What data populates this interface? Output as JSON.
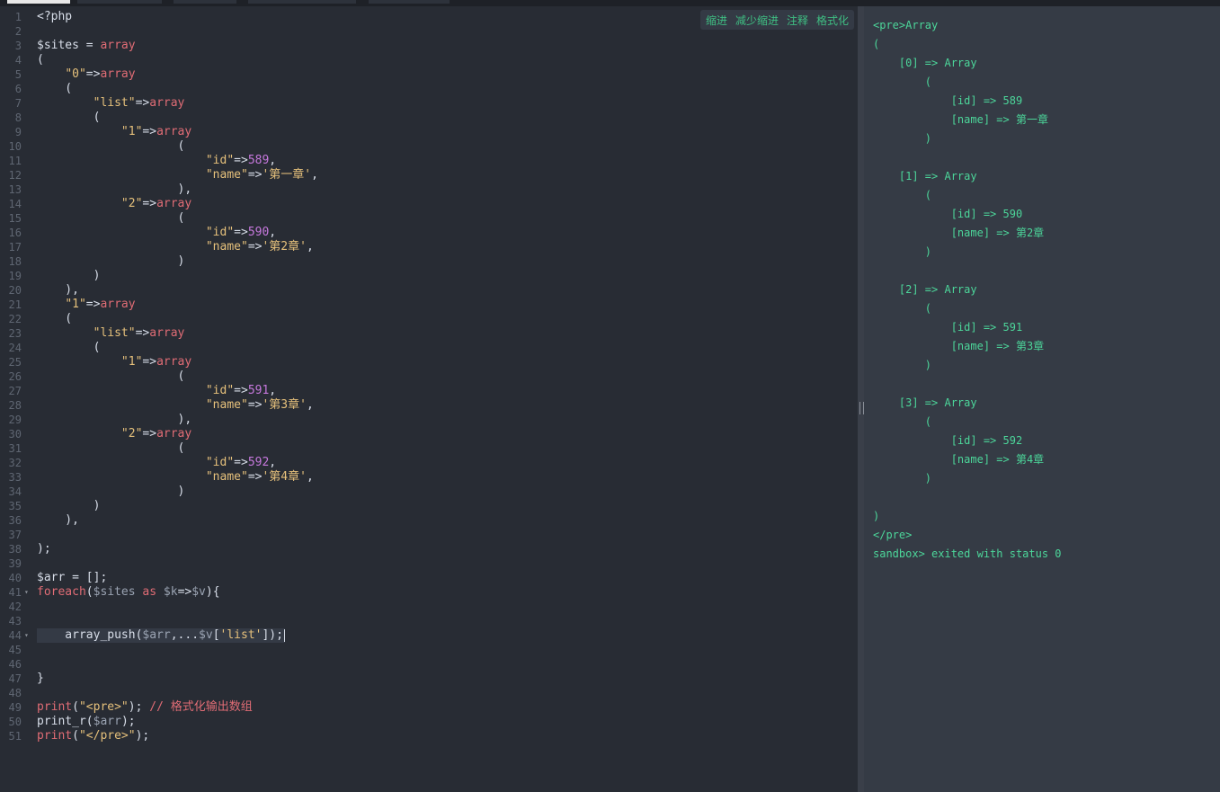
{
  "toolbar": {
    "indent": "缩进",
    "outdent": "减少缩进",
    "comment": "注释",
    "format": "格式化"
  },
  "editor": {
    "line_numbers": [
      "1",
      "2",
      "3",
      "4",
      "5",
      "6",
      "7",
      "8",
      "9",
      "10",
      "11",
      "12",
      "13",
      "14",
      "15",
      "16",
      "17",
      "18",
      "19",
      "20",
      "21",
      "22",
      "23",
      "24",
      "25",
      "26",
      "27",
      "28",
      "29",
      "30",
      "31",
      "32",
      "33",
      "34",
      "35",
      "36",
      "37",
      "38",
      "39",
      "40",
      "41",
      "42",
      "43",
      "44",
      "45",
      "46",
      "47",
      "48",
      "49",
      "50",
      "51"
    ],
    "lines": [
      [
        [
          "pl",
          "<?php"
        ]
      ],
      [],
      [
        [
          "var",
          "$sites"
        ],
        [
          "pl",
          " = "
        ],
        [
          "kw",
          "array"
        ]
      ],
      [
        [
          "pl",
          "("
        ]
      ],
      [
        [
          "pl",
          "    "
        ],
        [
          "str",
          "\"0\""
        ],
        [
          "pl",
          "=>"
        ],
        [
          "kw",
          "array"
        ]
      ],
      [
        [
          "pl",
          "    ("
        ]
      ],
      [
        [
          "pl",
          "        "
        ],
        [
          "str",
          "\"list\""
        ],
        [
          "pl",
          "=>"
        ],
        [
          "kw",
          "array"
        ]
      ],
      [
        [
          "pl",
          "        ("
        ]
      ],
      [
        [
          "pl",
          "            "
        ],
        [
          "str",
          "\"1\""
        ],
        [
          "pl",
          "=>"
        ],
        [
          "kw",
          "array"
        ]
      ],
      [
        [
          "pl",
          "                    ("
        ]
      ],
      [
        [
          "pl",
          "                        "
        ],
        [
          "str",
          "\"id\""
        ],
        [
          "pl",
          "=>"
        ],
        [
          "num",
          "589"
        ],
        [
          "pl",
          ","
        ]
      ],
      [
        [
          "pl",
          "                        "
        ],
        [
          "str",
          "\"name\""
        ],
        [
          "pl",
          "=>"
        ],
        [
          "str",
          "'第一章'"
        ],
        [
          "pl",
          ","
        ]
      ],
      [
        [
          "pl",
          "                    ),"
        ]
      ],
      [
        [
          "pl",
          "            "
        ],
        [
          "str",
          "\"2\""
        ],
        [
          "pl",
          "=>"
        ],
        [
          "kw",
          "array"
        ]
      ],
      [
        [
          "pl",
          "                    ("
        ]
      ],
      [
        [
          "pl",
          "                        "
        ],
        [
          "str",
          "\"id\""
        ],
        [
          "pl",
          "=>"
        ],
        [
          "num",
          "590"
        ],
        [
          "pl",
          ","
        ]
      ],
      [
        [
          "pl",
          "                        "
        ],
        [
          "str",
          "\"name\""
        ],
        [
          "pl",
          "=>"
        ],
        [
          "str",
          "'第2章'"
        ],
        [
          "pl",
          ","
        ]
      ],
      [
        [
          "pl",
          "                    )"
        ]
      ],
      [
        [
          "pl",
          "        )"
        ]
      ],
      [
        [
          "pl",
          "    ),"
        ]
      ],
      [
        [
          "pl",
          "    "
        ],
        [
          "str",
          "\"1\""
        ],
        [
          "pl",
          "=>"
        ],
        [
          "kw",
          "array"
        ]
      ],
      [
        [
          "pl",
          "    ("
        ]
      ],
      [
        [
          "pl",
          "        "
        ],
        [
          "str",
          "\"list\""
        ],
        [
          "pl",
          "=>"
        ],
        [
          "kw",
          "array"
        ]
      ],
      [
        [
          "pl",
          "        ("
        ]
      ],
      [
        [
          "pl",
          "            "
        ],
        [
          "str",
          "\"1\""
        ],
        [
          "pl",
          "=>"
        ],
        [
          "kw",
          "array"
        ]
      ],
      [
        [
          "pl",
          "                    ("
        ]
      ],
      [
        [
          "pl",
          "                        "
        ],
        [
          "str",
          "\"id\""
        ],
        [
          "pl",
          "=>"
        ],
        [
          "num",
          "591"
        ],
        [
          "pl",
          ","
        ]
      ],
      [
        [
          "pl",
          "                        "
        ],
        [
          "str",
          "\"name\""
        ],
        [
          "pl",
          "=>"
        ],
        [
          "str",
          "'第3章'"
        ],
        [
          "pl",
          ","
        ]
      ],
      [
        [
          "pl",
          "                    ),"
        ]
      ],
      [
        [
          "pl",
          "            "
        ],
        [
          "str",
          "\"2\""
        ],
        [
          "pl",
          "=>"
        ],
        [
          "kw",
          "array"
        ]
      ],
      [
        [
          "pl",
          "                    ("
        ]
      ],
      [
        [
          "pl",
          "                        "
        ],
        [
          "str",
          "\"id\""
        ],
        [
          "pl",
          "=>"
        ],
        [
          "num",
          "592"
        ],
        [
          "pl",
          ","
        ]
      ],
      [
        [
          "pl",
          "                        "
        ],
        [
          "str",
          "\"name\""
        ],
        [
          "pl",
          "=>"
        ],
        [
          "str",
          "'第4章'"
        ],
        [
          "pl",
          ","
        ]
      ],
      [
        [
          "pl",
          "                    )"
        ]
      ],
      [
        [
          "pl",
          "        )"
        ]
      ],
      [
        [
          "pl",
          "    ),"
        ]
      ],
      [],
      [
        [
          "pl",
          ");"
        ]
      ],
      [],
      [
        [
          "var",
          "$arr"
        ],
        [
          "pl",
          " = [];"
        ]
      ],
      [
        [
          "kw",
          "foreach"
        ],
        [
          "pl",
          "("
        ],
        [
          "var2",
          "$sites"
        ],
        [
          "pl",
          " "
        ],
        [
          "kw",
          "as"
        ],
        [
          "pl",
          " "
        ],
        [
          "var2",
          "$k"
        ],
        [
          "pl",
          "=>"
        ],
        [
          "var2",
          "$v"
        ],
        [
          "pl",
          "){"
        ]
      ],
      [],
      [],
      [
        [
          "pl",
          "    array_push("
        ],
        [
          "var2",
          "$arr"
        ],
        [
          "pl",
          ",..."
        ],
        [
          "var2",
          "$v"
        ],
        [
          "pl",
          "["
        ],
        [
          "str",
          "'list'"
        ],
        [
          "pl",
          "]);"
        ]
      ],
      [],
      [],
      [
        [
          "pl",
          "}"
        ]
      ],
      [],
      [
        [
          "kw",
          "print"
        ],
        [
          "pl",
          "("
        ],
        [
          "str",
          "\"<pre>\""
        ],
        [
          "pl",
          "); "
        ],
        [
          "cm",
          "// 格式化输出数组"
        ]
      ],
      [
        [
          "pl",
          "print_r("
        ],
        [
          "var2",
          "$arr"
        ],
        [
          "pl",
          ");"
        ]
      ],
      [
        [
          "kw",
          "print"
        ],
        [
          "pl",
          "("
        ],
        [
          "str",
          "\"</pre>\""
        ],
        [
          "pl",
          ");"
        ]
      ]
    ],
    "fold_markers": {
      "41": "▾",
      "44": "▾"
    }
  },
  "output": {
    "lines": [
      "<pre>Array",
      "(",
      "    [0] => Array",
      "        (",
      "            [id] => 589",
      "            [name] => 第一章",
      "        )",
      "",
      "    [1] => Array",
      "        (",
      "            [id] => 590",
      "            [name] => 第2章",
      "        )",
      "",
      "    [2] => Array",
      "        (",
      "            [id] => 591",
      "            [name] => 第3章",
      "        )",
      "",
      "    [3] => Array",
      "        (",
      "            [id] => 592",
      "            [name] => 第4章",
      "        )",
      "",
      ")",
      "</pre>",
      "sandbox> exited with status 0"
    ]
  }
}
